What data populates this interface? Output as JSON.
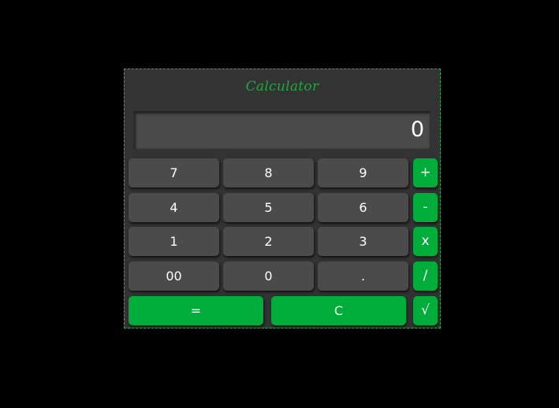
{
  "title": "Calculator",
  "display": {
    "value": "0"
  },
  "keys": {
    "row1": [
      "7",
      "8",
      "9",
      "+"
    ],
    "row2": [
      "4",
      "5",
      "6",
      "-"
    ],
    "row3": [
      "1",
      "2",
      "3",
      "x"
    ],
    "row4": [
      "00",
      "0",
      ".",
      "/"
    ],
    "row5": [
      "=",
      "C",
      "√"
    ]
  },
  "colors": {
    "accent": "#00ac3a",
    "border": "#22b14c",
    "panel": "#333333",
    "number_key": "#4b4b4b",
    "display": "#4a4a4a",
    "background": "#000000"
  }
}
